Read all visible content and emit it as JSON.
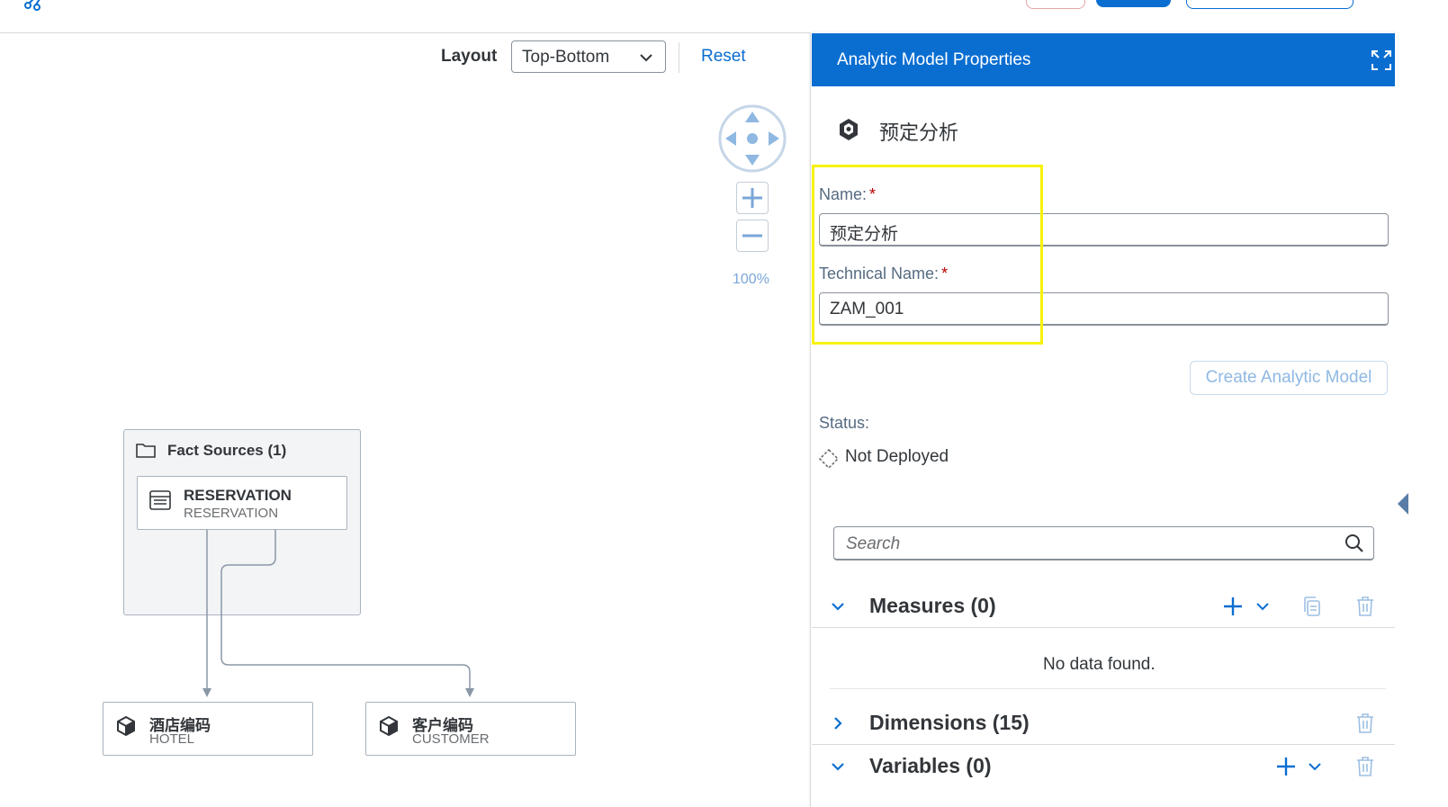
{
  "canvas": {
    "layout_label": "Layout",
    "layout_value": "Top-Bottom",
    "reset_label": "Reset",
    "zoom_level": "100%"
  },
  "diagram": {
    "fact_group_title": "Fact Sources (1)",
    "fact_node": {
      "title": "RESERVATION",
      "subtitle": "RESERVATION"
    },
    "dimension_nodes": [
      {
        "title": "酒店编码",
        "subtitle": "HOTEL"
      },
      {
        "title": "客户编码",
        "subtitle": "CUSTOMER"
      }
    ]
  },
  "panel": {
    "header_title": "Analytic Model Properties",
    "model_name": "预定分析",
    "name_label": "Name:",
    "name_value": "预定分析",
    "technical_name_label": "Technical Name:",
    "technical_name_value": "ZAM_001",
    "required_marker": "*",
    "create_button": "Create Analytic Model",
    "status_label": "Status:",
    "status_value": "Not Deployed",
    "search_placeholder": "Search",
    "sections": {
      "measures": "Measures (0)",
      "measures_empty": "No data found.",
      "dimensions": "Dimensions (15)",
      "variables": "Variables (0)"
    }
  },
  "colors": {
    "brand_blue": "#0a6ed1",
    "highlight_yellow": "#f6f20a",
    "required_red": "#bb0000"
  }
}
